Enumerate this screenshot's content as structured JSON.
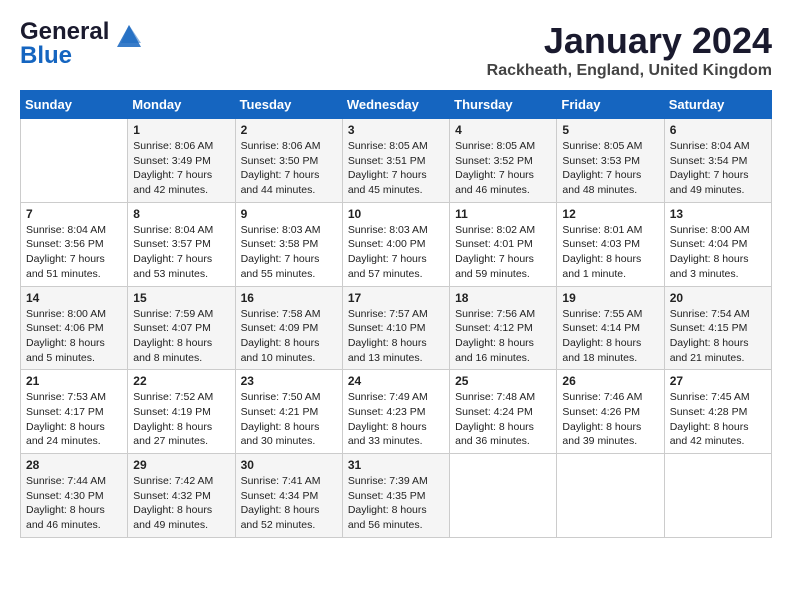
{
  "header": {
    "logo_general": "General",
    "logo_blue": "Blue",
    "month_year": "January 2024",
    "location": "Rackheath, England, United Kingdom"
  },
  "days_of_week": [
    "Sunday",
    "Monday",
    "Tuesday",
    "Wednesday",
    "Thursday",
    "Friday",
    "Saturday"
  ],
  "weeks": [
    [
      {
        "day": "",
        "sunrise": "",
        "sunset": "",
        "daylight": ""
      },
      {
        "day": "1",
        "sunrise": "Sunrise: 8:06 AM",
        "sunset": "Sunset: 3:49 PM",
        "daylight": "Daylight: 7 hours and 42 minutes."
      },
      {
        "day": "2",
        "sunrise": "Sunrise: 8:06 AM",
        "sunset": "Sunset: 3:50 PM",
        "daylight": "Daylight: 7 hours and 44 minutes."
      },
      {
        "day": "3",
        "sunrise": "Sunrise: 8:05 AM",
        "sunset": "Sunset: 3:51 PM",
        "daylight": "Daylight: 7 hours and 45 minutes."
      },
      {
        "day": "4",
        "sunrise": "Sunrise: 8:05 AM",
        "sunset": "Sunset: 3:52 PM",
        "daylight": "Daylight: 7 hours and 46 minutes."
      },
      {
        "day": "5",
        "sunrise": "Sunrise: 8:05 AM",
        "sunset": "Sunset: 3:53 PM",
        "daylight": "Daylight: 7 hours and 48 minutes."
      },
      {
        "day": "6",
        "sunrise": "Sunrise: 8:04 AM",
        "sunset": "Sunset: 3:54 PM",
        "daylight": "Daylight: 7 hours and 49 minutes."
      }
    ],
    [
      {
        "day": "7",
        "sunrise": "Sunrise: 8:04 AM",
        "sunset": "Sunset: 3:56 PM",
        "daylight": "Daylight: 7 hours and 51 minutes."
      },
      {
        "day": "8",
        "sunrise": "Sunrise: 8:04 AM",
        "sunset": "Sunset: 3:57 PM",
        "daylight": "Daylight: 7 hours and 53 minutes."
      },
      {
        "day": "9",
        "sunrise": "Sunrise: 8:03 AM",
        "sunset": "Sunset: 3:58 PM",
        "daylight": "Daylight: 7 hours and 55 minutes."
      },
      {
        "day": "10",
        "sunrise": "Sunrise: 8:03 AM",
        "sunset": "Sunset: 4:00 PM",
        "daylight": "Daylight: 7 hours and 57 minutes."
      },
      {
        "day": "11",
        "sunrise": "Sunrise: 8:02 AM",
        "sunset": "Sunset: 4:01 PM",
        "daylight": "Daylight: 7 hours and 59 minutes."
      },
      {
        "day": "12",
        "sunrise": "Sunrise: 8:01 AM",
        "sunset": "Sunset: 4:03 PM",
        "daylight": "Daylight: 8 hours and 1 minute."
      },
      {
        "day": "13",
        "sunrise": "Sunrise: 8:00 AM",
        "sunset": "Sunset: 4:04 PM",
        "daylight": "Daylight: 8 hours and 3 minutes."
      }
    ],
    [
      {
        "day": "14",
        "sunrise": "Sunrise: 8:00 AM",
        "sunset": "Sunset: 4:06 PM",
        "daylight": "Daylight: 8 hours and 5 minutes."
      },
      {
        "day": "15",
        "sunrise": "Sunrise: 7:59 AM",
        "sunset": "Sunset: 4:07 PM",
        "daylight": "Daylight: 8 hours and 8 minutes."
      },
      {
        "day": "16",
        "sunrise": "Sunrise: 7:58 AM",
        "sunset": "Sunset: 4:09 PM",
        "daylight": "Daylight: 8 hours and 10 minutes."
      },
      {
        "day": "17",
        "sunrise": "Sunrise: 7:57 AM",
        "sunset": "Sunset: 4:10 PM",
        "daylight": "Daylight: 8 hours and 13 minutes."
      },
      {
        "day": "18",
        "sunrise": "Sunrise: 7:56 AM",
        "sunset": "Sunset: 4:12 PM",
        "daylight": "Daylight: 8 hours and 16 minutes."
      },
      {
        "day": "19",
        "sunrise": "Sunrise: 7:55 AM",
        "sunset": "Sunset: 4:14 PM",
        "daylight": "Daylight: 8 hours and 18 minutes."
      },
      {
        "day": "20",
        "sunrise": "Sunrise: 7:54 AM",
        "sunset": "Sunset: 4:15 PM",
        "daylight": "Daylight: 8 hours and 21 minutes."
      }
    ],
    [
      {
        "day": "21",
        "sunrise": "Sunrise: 7:53 AM",
        "sunset": "Sunset: 4:17 PM",
        "daylight": "Daylight: 8 hours and 24 minutes."
      },
      {
        "day": "22",
        "sunrise": "Sunrise: 7:52 AM",
        "sunset": "Sunset: 4:19 PM",
        "daylight": "Daylight: 8 hours and 27 minutes."
      },
      {
        "day": "23",
        "sunrise": "Sunrise: 7:50 AM",
        "sunset": "Sunset: 4:21 PM",
        "daylight": "Daylight: 8 hours and 30 minutes."
      },
      {
        "day": "24",
        "sunrise": "Sunrise: 7:49 AM",
        "sunset": "Sunset: 4:23 PM",
        "daylight": "Daylight: 8 hours and 33 minutes."
      },
      {
        "day": "25",
        "sunrise": "Sunrise: 7:48 AM",
        "sunset": "Sunset: 4:24 PM",
        "daylight": "Daylight: 8 hours and 36 minutes."
      },
      {
        "day": "26",
        "sunrise": "Sunrise: 7:46 AM",
        "sunset": "Sunset: 4:26 PM",
        "daylight": "Daylight: 8 hours and 39 minutes."
      },
      {
        "day": "27",
        "sunrise": "Sunrise: 7:45 AM",
        "sunset": "Sunset: 4:28 PM",
        "daylight": "Daylight: 8 hours and 42 minutes."
      }
    ],
    [
      {
        "day": "28",
        "sunrise": "Sunrise: 7:44 AM",
        "sunset": "Sunset: 4:30 PM",
        "daylight": "Daylight: 8 hours and 46 minutes."
      },
      {
        "day": "29",
        "sunrise": "Sunrise: 7:42 AM",
        "sunset": "Sunset: 4:32 PM",
        "daylight": "Daylight: 8 hours and 49 minutes."
      },
      {
        "day": "30",
        "sunrise": "Sunrise: 7:41 AM",
        "sunset": "Sunset: 4:34 PM",
        "daylight": "Daylight: 8 hours and 52 minutes."
      },
      {
        "day": "31",
        "sunrise": "Sunrise: 7:39 AM",
        "sunset": "Sunset: 4:35 PM",
        "daylight": "Daylight: 8 hours and 56 minutes."
      },
      {
        "day": "",
        "sunrise": "",
        "sunset": "",
        "daylight": ""
      },
      {
        "day": "",
        "sunrise": "",
        "sunset": "",
        "daylight": ""
      },
      {
        "day": "",
        "sunrise": "",
        "sunset": "",
        "daylight": ""
      }
    ]
  ]
}
